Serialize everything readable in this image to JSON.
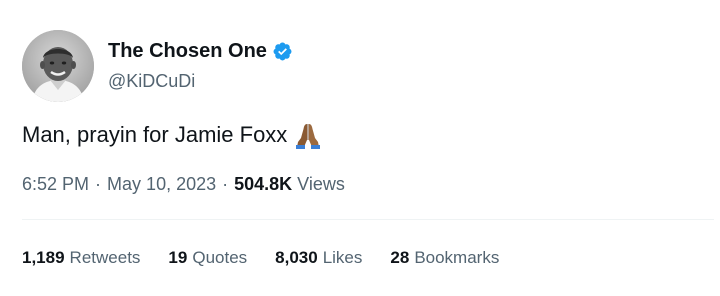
{
  "author": {
    "display_name": "The Chosen One",
    "handle": "@KiDCuDi",
    "verified": true
  },
  "tweet": {
    "text": "Man, prayin for Jamie Foxx",
    "emoji": "pray-icon"
  },
  "meta": {
    "time": "6:52 PM",
    "separator": "·",
    "date": "May 10, 2023",
    "views_count": "504.8K",
    "views_label": "Views"
  },
  "stats": [
    {
      "count": "1,189",
      "label": "Retweets"
    },
    {
      "count": "19",
      "label": "Quotes"
    },
    {
      "count": "8,030",
      "label": "Likes"
    },
    {
      "count": "28",
      "label": "Bookmarks"
    }
  ],
  "colors": {
    "text_primary": "#0f1419",
    "text_secondary": "#536471",
    "verified_blue": "#1d9bf0",
    "divider": "#eff3f4"
  }
}
